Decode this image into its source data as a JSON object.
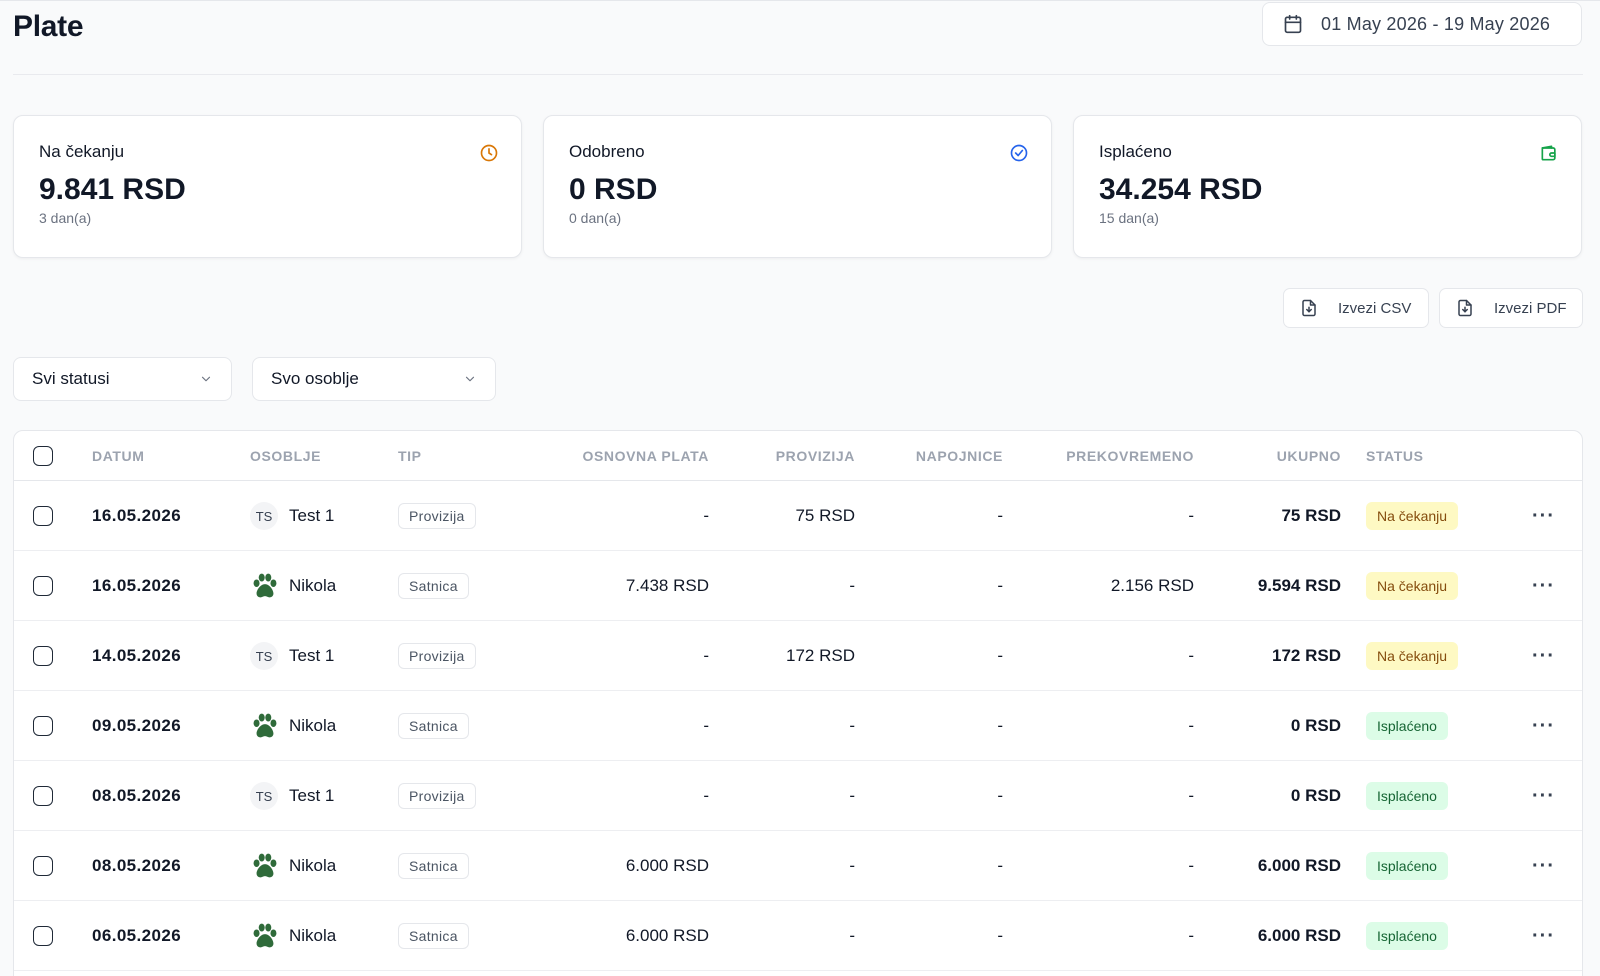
{
  "header": {
    "title": "Plate",
    "date_range": "01 May 2026 - 19 May 2026"
  },
  "cards": [
    {
      "label": "Na čekanju",
      "value": "9.841 RSD",
      "sub": "3 dan(a)",
      "icon": "clock-icon",
      "color": "#d97706"
    },
    {
      "label": "Odobreno",
      "value": "0 RSD",
      "sub": "0 dan(a)",
      "icon": "check-circle-icon",
      "color": "#2563eb"
    },
    {
      "label": "Isplaćeno",
      "value": "34.254 RSD",
      "sub": "15 dan(a)",
      "icon": "wallet-icon",
      "color": "#16a34a"
    }
  ],
  "actions": {
    "export_csv": "Izvezi CSV",
    "export_pdf": "Izvezi PDF"
  },
  "filters": {
    "status": "Svi statusi",
    "staff": "Svo osoblje"
  },
  "table": {
    "columns": {
      "datum": "DATUM",
      "osoblje": "OSOBLJE",
      "tip": "TIP",
      "osnovna": "OSNOVNA PLATA",
      "provizija": "PROVIZIJA",
      "napojnice": "NAPOJNICE",
      "prekovremeno": "PREKOVREMENO",
      "ukupno": "UKUPNO",
      "status": "STATUS"
    },
    "rows": [
      {
        "date": "16.05.2026",
        "avatar": "TS",
        "staff": "Test 1",
        "type": "Provizija",
        "base": "-",
        "commission": "75 RSD",
        "tips": "-",
        "overtime": "-",
        "total": "75 RSD",
        "status": "Na čekanju",
        "status_kind": "pending"
      },
      {
        "date": "16.05.2026",
        "avatar": "paw",
        "staff": "Nikola",
        "type": "Satnica",
        "base": "7.438 RSD",
        "commission": "-",
        "tips": "-",
        "overtime": "2.156 RSD",
        "total": "9.594 RSD",
        "status": "Na čekanju",
        "status_kind": "pending"
      },
      {
        "date": "14.05.2026",
        "avatar": "TS",
        "staff": "Test 1",
        "type": "Provizija",
        "base": "-",
        "commission": "172 RSD",
        "tips": "-",
        "overtime": "-",
        "total": "172 RSD",
        "status": "Na čekanju",
        "status_kind": "pending"
      },
      {
        "date": "09.05.2026",
        "avatar": "paw",
        "staff": "Nikola",
        "type": "Satnica",
        "base": "-",
        "commission": "-",
        "tips": "-",
        "overtime": "-",
        "total": "0 RSD",
        "status": "Isplaćeno",
        "status_kind": "paid"
      },
      {
        "date": "08.05.2026",
        "avatar": "TS",
        "staff": "Test 1",
        "type": "Provizija",
        "base": "-",
        "commission": "-",
        "tips": "-",
        "overtime": "-",
        "total": "0 RSD",
        "status": "Isplaćeno",
        "status_kind": "paid"
      },
      {
        "date": "08.05.2026",
        "avatar": "paw",
        "staff": "Nikola",
        "type": "Satnica",
        "base": "6.000 RSD",
        "commission": "-",
        "tips": "-",
        "overtime": "-",
        "total": "6.000 RSD",
        "status": "Isplaćeno",
        "status_kind": "paid"
      },
      {
        "date": "06.05.2026",
        "avatar": "paw",
        "staff": "Nikola",
        "type": "Satnica",
        "base": "6.000 RSD",
        "commission": "-",
        "tips": "-",
        "overtime": "-",
        "total": "6.000 RSD",
        "status": "Isplaćeno",
        "status_kind": "paid"
      }
    ]
  }
}
